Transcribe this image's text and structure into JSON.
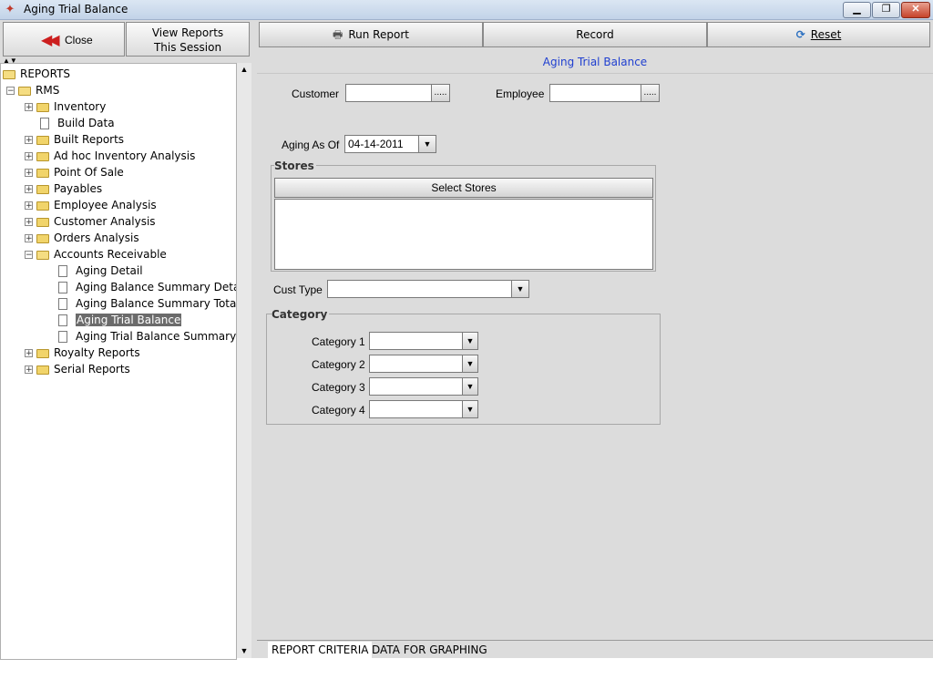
{
  "window": {
    "title": "Aging Trial Balance"
  },
  "left": {
    "close_label": "Close",
    "view_reports_line1": "View Reports",
    "view_reports_line2": "This Session"
  },
  "tree": {
    "root": "REPORTS",
    "rms": "RMS",
    "items": [
      "Inventory",
      "Build Data",
      "Built Reports",
      "Ad hoc Inventory  Analysis",
      "Point Of Sale",
      "Payables",
      "Employee Analysis",
      "Customer Analysis",
      "Orders Analysis",
      "Accounts Receivable"
    ],
    "ar_children": [
      "Aging Detail",
      "Aging Balance Summary Detail",
      "Aging Balance Summary Totals",
      "Aging Trial Balance",
      "Aging Trial Balance Summary"
    ],
    "after": [
      "Royalty Reports",
      "Serial Reports"
    ]
  },
  "toolbar": {
    "run_report": "Run Report",
    "record": "Record",
    "reset": "Reset"
  },
  "report": {
    "heading": "Aging Trial Balance",
    "customer_label": "Customer",
    "customer_value": "",
    "employee_label": "Employee",
    "employee_value": "",
    "ellipsis": ".....",
    "aging_as_of_label": "Aging As Of",
    "aging_as_of_value": "04-14-2011",
    "stores_title": "Stores",
    "select_stores": "Select Stores",
    "cust_type_label": "Cust Type",
    "cust_type_value": "",
    "category_title": "Category",
    "categories": [
      {
        "label": "Category 1",
        "value": ""
      },
      {
        "label": "Category 2",
        "value": ""
      },
      {
        "label": "Category 3",
        "value": ""
      },
      {
        "label": "Category 4",
        "value": ""
      }
    ]
  },
  "tabs": {
    "criteria": "REPORT CRITERIA",
    "graphing": "DATA FOR GRAPHING"
  },
  "colors": {
    "heading": "#1f3fd0",
    "close_arrow": "#cc1e1e",
    "selection": "#6b6b6b"
  }
}
